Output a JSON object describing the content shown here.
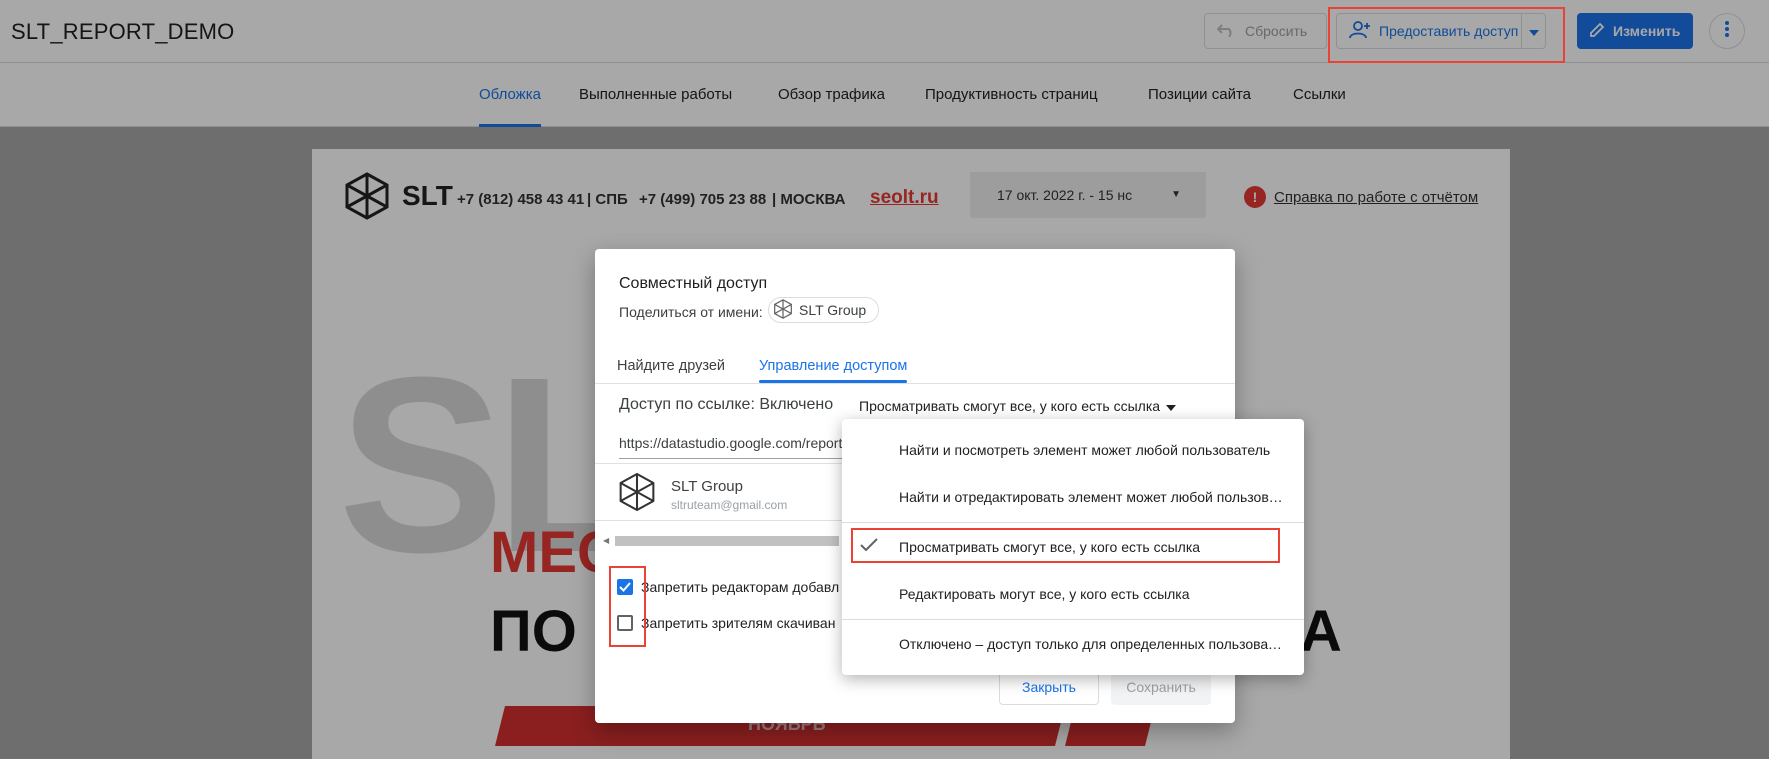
{
  "header": {
    "title": "SLT_REPORT_DEMO",
    "reset_label": "Сбросить",
    "share_label": "Предоставить доступ",
    "edit_label": "Изменить"
  },
  "nav": {
    "tabs": [
      "Обложка",
      "Выполненные работы",
      "Обзор трафика",
      "Продуктивность страниц",
      "Позиции сайта",
      "Ссылки"
    ]
  },
  "report": {
    "logo_text": "SLT",
    "phone_spb": "+7 (812) 458 43 41",
    "city_spb": "| СПБ",
    "phone_msk": "+7 (499) 705 23 88",
    "city_msk": "| МОСКВА",
    "site": "seolt.ru",
    "date_range": "17 окт. 2022 г. - 15 нс",
    "help_label": "Справка по работе с отчётом",
    "bg_text": "SL",
    "hero_line1": "МЕС",
    "hero_line2": "ПО",
    "hero_line2_end": "А",
    "band_text": "НОЯБРЬ"
  },
  "dialog": {
    "title": "Совместный доступ",
    "share_from_label": "Поделиться от имени:",
    "owner": "SLT Group",
    "tabs": [
      "Найдите друзей",
      "Управление доступом"
    ],
    "link_access_label": "Доступ по ссылке: Включено",
    "link_permission": "Просматривать смогут все, у кого есть ссылка",
    "url": "https://datastudio.google.com/reporting/",
    "user_name": "SLT Group",
    "user_email": "sltruteam@gmail.com",
    "checkbox1_label": "Запретить редакторам добавл",
    "checkbox1_checked": true,
    "checkbox2_label": "Запретить зрителям скачиван",
    "checkbox2_checked": false,
    "close_label": "Закрыть",
    "save_label": "Сохранить"
  },
  "menu": {
    "items": [
      "Найти и посмотреть элемент может любой пользователь",
      "Найти и отредактировать элемент может любой пользователь",
      "Просматривать смогут все, у кого есть ссылка",
      "Редактировать могут все, у кого есть ссылка",
      "Отключено – доступ только для определенных пользователей"
    ],
    "selected_index": 2
  },
  "colors": {
    "accent": "#1a73e8",
    "highlight": "#ea4335",
    "brand_red": "#e53935"
  }
}
